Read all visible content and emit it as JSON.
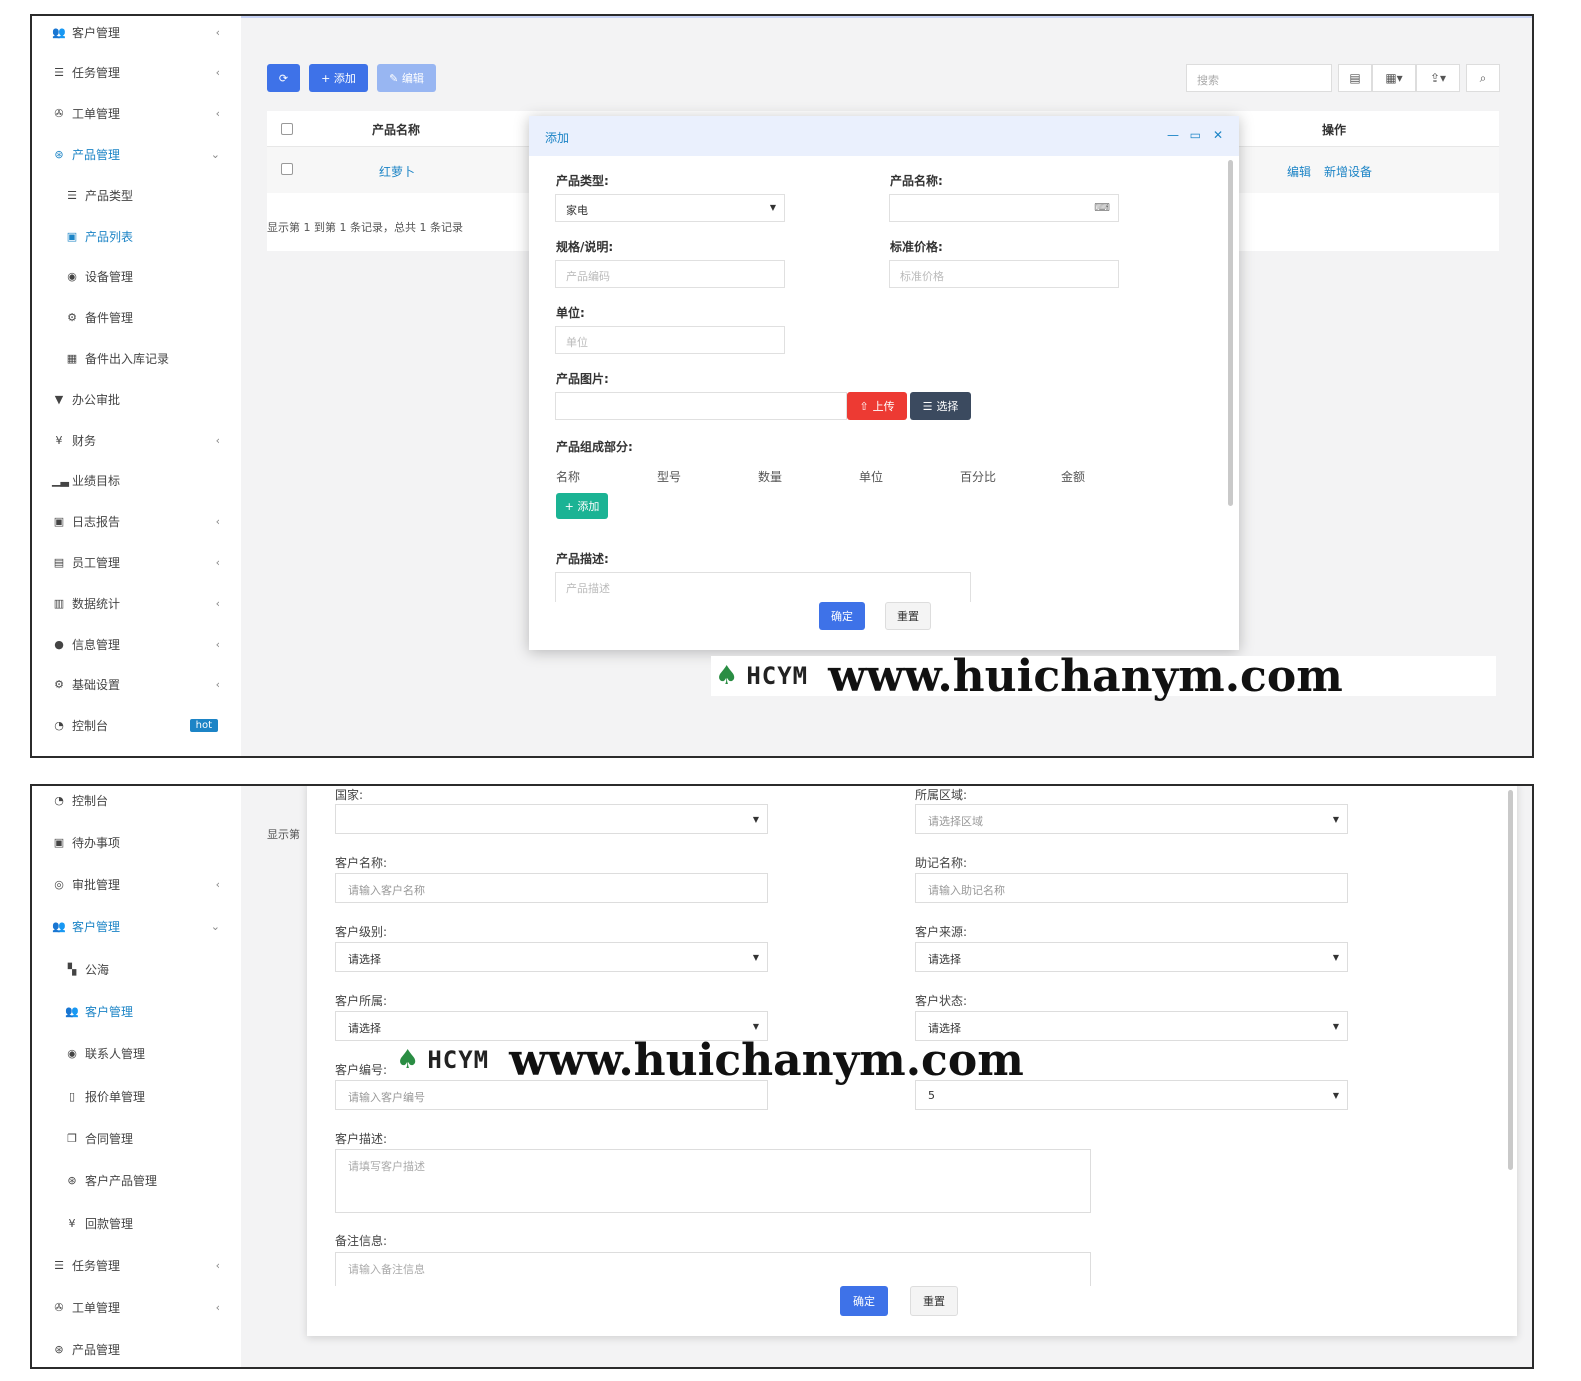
{
  "shot1": {
    "sidebar": [
      {
        "label": "客户管理",
        "icon": "users-icon",
        "arrow": "‹"
      },
      {
        "label": "任务管理",
        "icon": "list-icon",
        "arrow": "‹"
      },
      {
        "label": "工单管理",
        "icon": "wrench-icon",
        "arrow": "‹"
      },
      {
        "label": "产品管理",
        "icon": "product-icon",
        "arrow": "⌄",
        "active": true
      },
      {
        "label": "产品类型",
        "icon": "list-icon",
        "sub": true
      },
      {
        "label": "产品列表",
        "icon": "box-icon",
        "sub": true,
        "active": true
      },
      {
        "label": "设备管理",
        "icon": "device-icon",
        "sub": true
      },
      {
        "label": "备件管理",
        "icon": "gears-icon",
        "sub": true
      },
      {
        "label": "备件出入库记录",
        "icon": "table-icon",
        "sub": true
      },
      {
        "label": "办公审批",
        "icon": "filter-icon"
      },
      {
        "label": "财务",
        "icon": "yen-icon",
        "arrow": "‹"
      },
      {
        "label": "业绩目标",
        "icon": "signal-icon"
      },
      {
        "label": "日志报告",
        "icon": "calendar-icon",
        "arrow": "‹"
      },
      {
        "label": "员工管理",
        "icon": "id-card-icon",
        "arrow": "‹"
      },
      {
        "label": "数据统计",
        "icon": "bar-chart-icon",
        "arrow": "‹"
      },
      {
        "label": "信息管理",
        "icon": "comments-icon",
        "arrow": "‹"
      },
      {
        "label": "基础设置",
        "icon": "cogs-icon",
        "arrow": "‹"
      },
      {
        "label": "控制台",
        "icon": "dashboard-icon",
        "badge": "hot"
      }
    ],
    "toolbar": {
      "add_label": "+ 添加",
      "edit_label": "✎ 编辑",
      "search_placeholder": "搜索"
    },
    "table": {
      "headers": {
        "name": "产品名称",
        "ops": "操作"
      },
      "row": {
        "name": "红萝卜",
        "edit": "编辑",
        "add_device": "新增设备"
      },
      "footer": "显示第 1 到第 1 条记录，总共 1 条记录"
    },
    "modal": {
      "title": "添加",
      "type_label": "产品类型:",
      "type_value": "家电",
      "name_label": "产品名称:",
      "spec_label": "规格/说明:",
      "spec_placeholder": "产品编码",
      "price_label": "标准价格:",
      "price_placeholder": "标准价格",
      "unit_label": "单位:",
      "unit_placeholder": "单位",
      "image_label": "产品图片:",
      "upload_label": "上传",
      "choose_label": "选择",
      "parts_label": "产品组成部分:",
      "parts_columns": [
        "名称",
        "型号",
        "数量",
        "单位",
        "百分比",
        "金额"
      ],
      "parts_add_label": "+ 添加",
      "desc_label": "产品描述:",
      "desc_placeholder": "产品描述",
      "confirm_label": "确定",
      "reset_label": "重置"
    }
  },
  "shot2": {
    "sidebar": [
      {
        "label": "控制台",
        "icon": "dashboard-icon"
      },
      {
        "label": "待办事项",
        "icon": "calendar-icon"
      },
      {
        "label": "审批管理",
        "icon": "eye-icon",
        "arrow": "‹"
      },
      {
        "label": "客户管理",
        "icon": "users-icon",
        "arrow": "⌄",
        "active": true
      },
      {
        "label": "公海",
        "icon": "map-icon",
        "sub": true
      },
      {
        "label": "客户管理",
        "icon": "users-icon",
        "sub": true,
        "active": true
      },
      {
        "label": "联系人管理",
        "icon": "user-circle-icon",
        "sub": true
      },
      {
        "label": "报价单管理",
        "icon": "file-icon",
        "sub": true
      },
      {
        "label": "合同管理",
        "icon": "copy-icon",
        "sub": true
      },
      {
        "label": "客户产品管理",
        "icon": "product-icon",
        "sub": true
      },
      {
        "label": "回款管理",
        "icon": "yen-icon",
        "sub": true
      },
      {
        "label": "任务管理",
        "icon": "list-icon",
        "arrow": "‹"
      },
      {
        "label": "工单管理",
        "icon": "wrench-icon",
        "arrow": "‹"
      },
      {
        "label": "产品管理",
        "icon": "product-icon"
      }
    ],
    "behind_text": "显示第",
    "form": {
      "country_label": "国家:",
      "region_label": "所属区域:",
      "region_placeholder": "请选择区域",
      "name_label": "客户名称:",
      "name_placeholder": "请输入客户名称",
      "mnemonic_label": "助记名称:",
      "mnemonic_placeholder": "请输入助记名称",
      "level_label": "客户级别:",
      "level_value": "请选择",
      "source_label": "客户来源:",
      "source_value": "请选择",
      "owner_label": "客户所属:",
      "owner_value": "请选择",
      "status_label": "客户状态:",
      "status_value": "请选择",
      "code_label": "客户编号:",
      "code_placeholder": "请输入客户编号",
      "right_value": "5",
      "desc_label": "客户描述:",
      "desc_placeholder": "请填写客户描述",
      "note_label": "备注信息:",
      "note_placeholder": "请输入备注信息",
      "confirm_label": "确定",
      "reset_label": "重置"
    }
  },
  "watermark": {
    "logo": "HCYM",
    "url": "www.huichanym.com"
  },
  "colors": {
    "primary": "#1c84c6",
    "blue_btn": "#3e72e8",
    "upload": "#ed3a33",
    "choose": "#3b4a5f",
    "teal": "#1bb394"
  }
}
